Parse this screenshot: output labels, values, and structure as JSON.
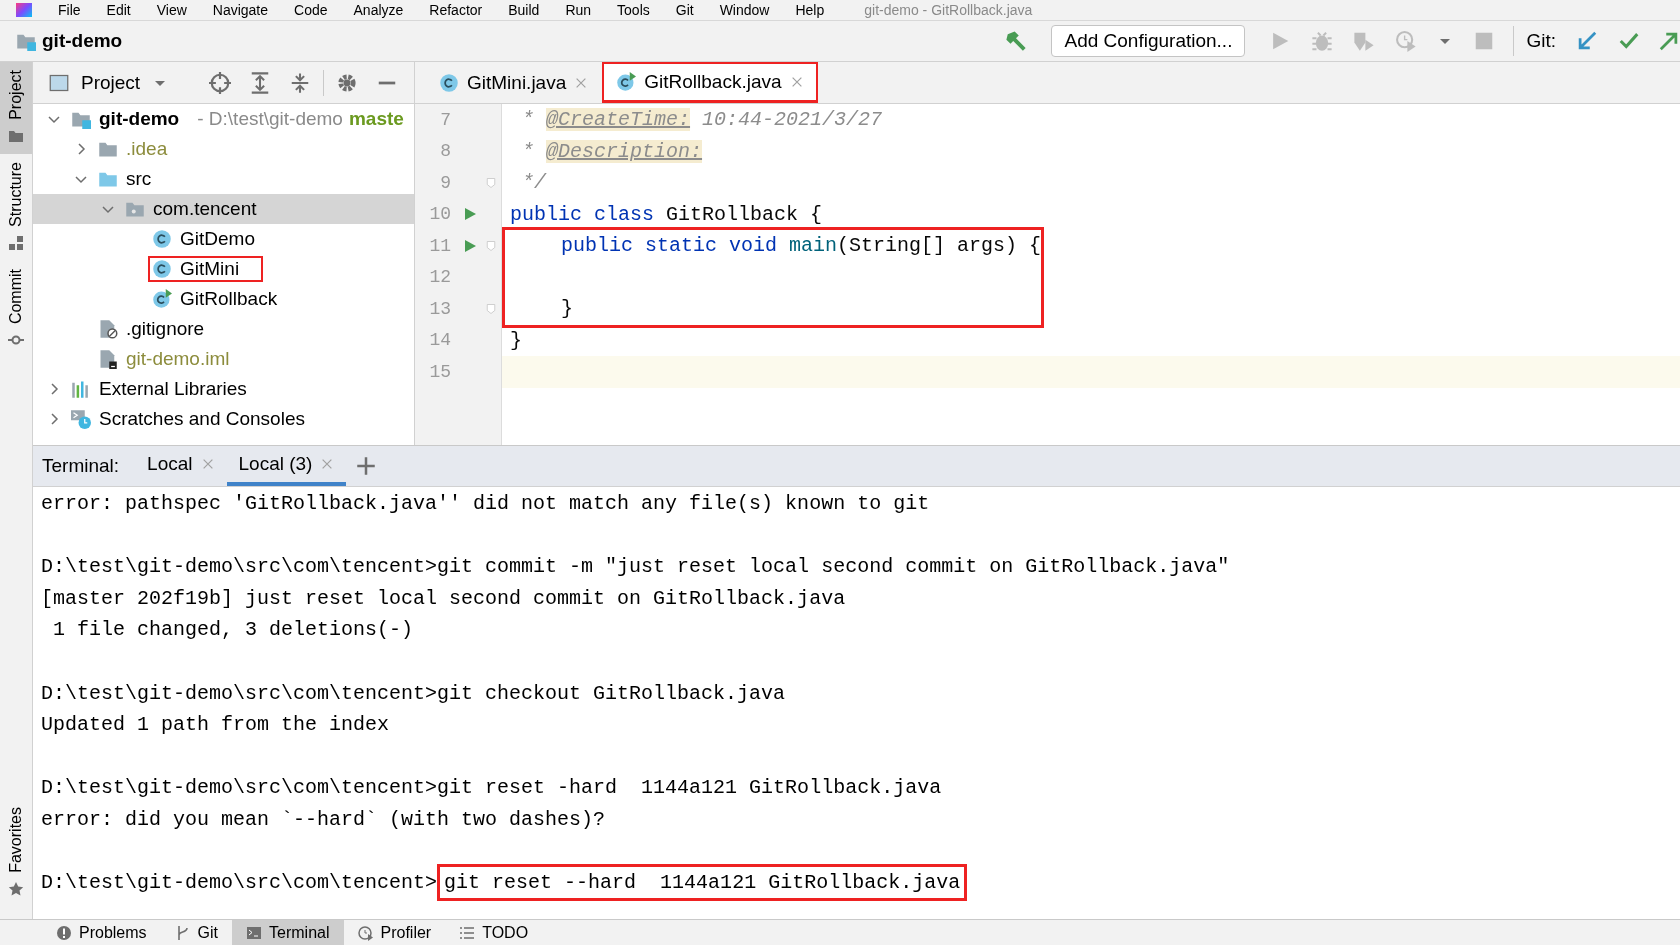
{
  "menu_bar": {
    "items": [
      "File",
      "Edit",
      "View",
      "Navigate",
      "Code",
      "Analyze",
      "Refactor",
      "Build",
      "Run",
      "Tools",
      "Git",
      "Window",
      "Help"
    ],
    "title": "git-demo - GitRollback.java"
  },
  "toolbar": {
    "project_name": "git-demo",
    "run_configuration": "Add Configuration...",
    "git_label": "Git:"
  },
  "tool_stripe": [
    {
      "label": "Project",
      "selected": true
    },
    {
      "label": "Structure",
      "selected": false
    },
    {
      "label": "Commit",
      "selected": false
    },
    {
      "label": "Favorites",
      "selected": false
    }
  ],
  "project_panel": {
    "title": "Project",
    "tree": [
      {
        "label": "git-demo",
        "kind": "module",
        "path": "- D:\\test\\git-demo",
        "branch": "maste",
        "expanded": true,
        "selected": false,
        "highlighted": false,
        "ignored": false,
        "children": [
          {
            "label": ".idea",
            "kind": "folder",
            "expanded": false,
            "selected": false,
            "highlighted": false,
            "ignored": true
          },
          {
            "label": "src",
            "kind": "source-folder",
            "expanded": true,
            "selected": false,
            "highlighted": false,
            "ignored": false,
            "children": [
              {
                "label": "com.tencent",
                "kind": "package",
                "expanded": true,
                "selected": true,
                "highlighted": false,
                "ignored": false,
                "children": [
                  {
                    "label": "GitDemo",
                    "kind": "class",
                    "selected": false,
                    "highlighted": false,
                    "ignored": false
                  },
                  {
                    "label": "GitMini",
                    "kind": "class",
                    "selected": false,
                    "highlighted": true,
                    "ignored": false
                  },
                  {
                    "label": "GitRollback",
                    "kind": "runnable-class",
                    "selected": false,
                    "highlighted": false,
                    "ignored": false
                  }
                ]
              }
            ]
          },
          {
            "label": ".gitignore",
            "kind": "ignore-file",
            "selected": false,
            "highlighted": false,
            "ignored": false
          },
          {
            "label": "git-demo.iml",
            "kind": "iml-file",
            "selected": false,
            "highlighted": false,
            "ignored": true
          }
        ]
      },
      {
        "label": "External Libraries",
        "kind": "libraries",
        "expanded": false,
        "selected": false,
        "highlighted": false,
        "ignored": false
      },
      {
        "label": "Scratches and Consoles",
        "kind": "scratches",
        "expanded": false,
        "selected": false,
        "highlighted": false,
        "ignored": false
      }
    ]
  },
  "editor": {
    "tabs": [
      {
        "label": "GitMini.java",
        "kind": "class",
        "selected": false,
        "highlighted": false
      },
      {
        "label": "GitRollback.java",
        "kind": "runnable-class",
        "selected": true,
        "highlighted": true
      }
    ],
    "lines": [
      {
        "number": "7",
        "run_marker": false,
        "fold": false,
        "current": false,
        "highlighted": false,
        "tokens": [
          {
            "text": " * ",
            "kind": "comment"
          },
          {
            "text": "@CreateTime:",
            "kind": "doc-tag"
          },
          {
            "text": " 10:44-2021/3/27",
            "kind": "comment"
          }
        ]
      },
      {
        "number": "8",
        "run_marker": false,
        "fold": false,
        "current": false,
        "highlighted": false,
        "tokens": [
          {
            "text": " * ",
            "kind": "comment"
          },
          {
            "text": "@Description:",
            "kind": "doc-tag"
          }
        ]
      },
      {
        "number": "9",
        "run_marker": false,
        "fold": true,
        "current": false,
        "highlighted": false,
        "tokens": [
          {
            "text": " */",
            "kind": "comment"
          }
        ]
      },
      {
        "number": "10",
        "run_marker": true,
        "fold": false,
        "current": false,
        "highlighted": false,
        "tokens": [
          {
            "text": "public class",
            "kind": "keyword"
          },
          {
            "text": " GitRollback {",
            "kind": "plain"
          }
        ]
      },
      {
        "number": "11",
        "run_marker": true,
        "fold": true,
        "current": false,
        "highlighted": true,
        "tokens": [
          {
            "text": "    public static void",
            "kind": "keyword"
          },
          {
            "text": " main",
            "kind": "method"
          },
          {
            "text": "(String[] args) {",
            "kind": "plain"
          }
        ]
      },
      {
        "number": "12",
        "run_marker": false,
        "fold": false,
        "current": false,
        "highlighted": true
      },
      {
        "number": "13",
        "run_marker": false,
        "fold": true,
        "current": false,
        "highlighted": true,
        "tokens": [
          {
            "text": "    }",
            "kind": "plain"
          }
        ]
      },
      {
        "number": "14",
        "run_marker": false,
        "fold": false,
        "current": false,
        "highlighted": false,
        "tokens": [
          {
            "text": "}",
            "kind": "plain"
          }
        ]
      },
      {
        "number": "15",
        "run_marker": false,
        "fold": false,
        "current": true,
        "highlighted": false
      }
    ]
  },
  "terminal": {
    "label": "Terminal:",
    "tabs": [
      {
        "label": "Local",
        "selected": false
      },
      {
        "label": "Local (3)",
        "selected": true
      }
    ],
    "blocks": [
      [
        {
          "text": "error: pathspec 'GitRollback.java'' did not match any file(s) known to git"
        }
      ],
      [
        {
          "text": "D:\\test\\git-demo\\src\\com\\tencent>git commit -m \"just reset local second commit on GitRollback.java\""
        },
        {
          "text": "[master 202f19b] just reset local second commit on GitRollback.java"
        },
        {
          "text": " 1 file changed, 3 deletions(-)"
        }
      ],
      [
        {
          "text": "D:\\test\\git-demo\\src\\com\\tencent>git checkout GitRollback.java"
        },
        {
          "text": "Updated 1 path from the index"
        }
      ],
      [
        {
          "text": "D:\\test\\git-demo\\src\\com\\tencent>git reset -hard  1144a121 GitRollback.java"
        },
        {
          "text": "error: did you mean `--hard` (with two dashes)?"
        }
      ],
      [
        {
          "prompt": "D:\\test\\git-demo\\src\\com\\tencent>",
          "command": "git reset --hard  1144a121 GitRollback.java",
          "highlighted": true
        }
      ]
    ]
  },
  "status_bar": {
    "tools": [
      {
        "label": "Problems",
        "selected": false
      },
      {
        "label": "Git",
        "selected": false
      },
      {
        "label": "Terminal",
        "selected": true
      },
      {
        "label": "Profiler",
        "selected": false
      },
      {
        "label": "TODO",
        "selected": false
      }
    ]
  }
}
